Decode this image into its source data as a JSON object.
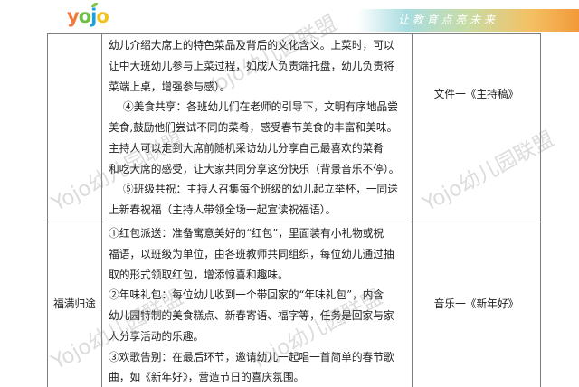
{
  "header": {
    "logo_letters": [
      "y",
      "o",
      "j",
      "o"
    ],
    "slogan": "让 教 育 点 亮 未 来"
  },
  "watermark": "Yojo幼儿园联盟",
  "colors": {
    "border": "#7d7d7d",
    "text": "#1c1c1c",
    "banner_left": "#a9dde0",
    "banner_right": "#f29a3a"
  },
  "table": {
    "rows": [
      {
        "content": [
          "幼儿介绍大席上的特色菜品及背后的文化含义。上菜时，可以",
          "让中大班幼儿参与上菜过程，如成人负责端托盘，幼儿负责将",
          "菜端上桌，增强参与感）。",
          "④美食共享：各班幼儿们在老师的引导下，文明有序地品尝",
          "美食,鼓励他们尝试不同的菜肴，感受春节美食的丰富和美味。",
          "主持人可以走到大席前随机采访幼儿分享自己最喜欢的菜肴",
          "和吃大席的感受，让大家共同分享这份快乐（背景音乐不停）。",
          "⑤班级共祝：主持人召集每个班级的幼儿起立举杯，一同送",
          "上新春祝福（主持人带领全场一起宣读祝福语）。"
        ],
        "resource": "文件一《主持稿》"
      },
      {
        "section": "福满归途",
        "content": [
          "①红包派送：准备寓意美好的“红包”，里面装有小礼物或祝",
          "福语，以班级为单位，由各班教师共同组织，每位幼儿通过抽",
          "取的形式领取红包，增添惊喜和趣味。",
          "②年味礼包：每位幼儿收到一个带回家的“年味礼包”，内含",
          "幼儿园特制的美食糕点、新春寄语、福字等，任务是回家与家",
          "人分享活动的乐趣。",
          "③欢歌告别：在最后环节，邀请幼儿一起唱一首简单的春节歌",
          "曲，如《新年好》，营造节日的喜庆氛围。"
        ],
        "resource": "音乐一《新年好》"
      }
    ]
  }
}
